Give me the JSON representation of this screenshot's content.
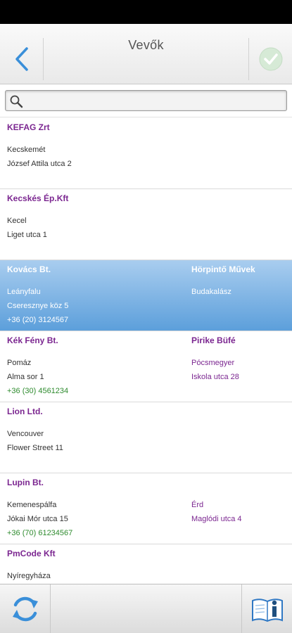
{
  "header": {
    "title": "Vevők",
    "back_icon": "chevron-left-icon",
    "confirm_icon": "checkmark-icon"
  },
  "search": {
    "value": "",
    "placeholder": "",
    "icon": "search-icon"
  },
  "customers": [
    {
      "name": "KEFAG Zrt",
      "city": "Kecskemét",
      "street": "József Attila utca 2",
      "phone": "",
      "alt_name": "",
      "alt_city": "",
      "alt_street": "",
      "selected": false
    },
    {
      "name": "Kecskés Ép.Kft",
      "city": "Kecel",
      "street": "Liget utca 1",
      "phone": "",
      "alt_name": "",
      "alt_city": "",
      "alt_street": "",
      "selected": false
    },
    {
      "name": "Kovács Bt.",
      "city": "Leányfalu",
      "street": "Cseresznye köz 5",
      "phone": "+36 (20) 3124567",
      "alt_name": "Hörpintő Művek",
      "alt_city": "Budakalász",
      "alt_street": "",
      "selected": true
    },
    {
      "name": "Kék Fény Bt.",
      "city": "Pomáz",
      "street": "Alma sor 1",
      "phone": "+36 (30) 4561234",
      "alt_name": "Pirike Büfé",
      "alt_city": "Pócsmegyer",
      "alt_street": "Iskola utca 28",
      "selected": false
    },
    {
      "name": "Lion Ltd.",
      "city": "Vencouver",
      "street": "Flower Street 11",
      "phone": "",
      "alt_name": "",
      "alt_city": "",
      "alt_street": "",
      "selected": false
    },
    {
      "name": "Lupin Bt.",
      "city": "Kemenespálfa",
      "street": "Jókai Mór utca 15",
      "phone": "+36 (70) 61234567",
      "alt_name": "",
      "alt_city": "Érd",
      "alt_street": "Maglódi utca 4",
      "selected": false
    },
    {
      "name": "PmCode Kft",
      "city": "Nyíregyháza",
      "street": "",
      "phone": "",
      "alt_name": "",
      "alt_city": "",
      "alt_street": "",
      "selected": false
    }
  ],
  "footer": {
    "refresh_icon": "refresh-icon",
    "info_icon": "book-info-icon"
  },
  "colors": {
    "name": "#7b2690",
    "phone": "#2e8b2e",
    "selected_top": "#a9cdef",
    "selected_bottom": "#5c9fdb",
    "back_arrow": "#3a8fd9",
    "check": "#b9d8b9"
  }
}
